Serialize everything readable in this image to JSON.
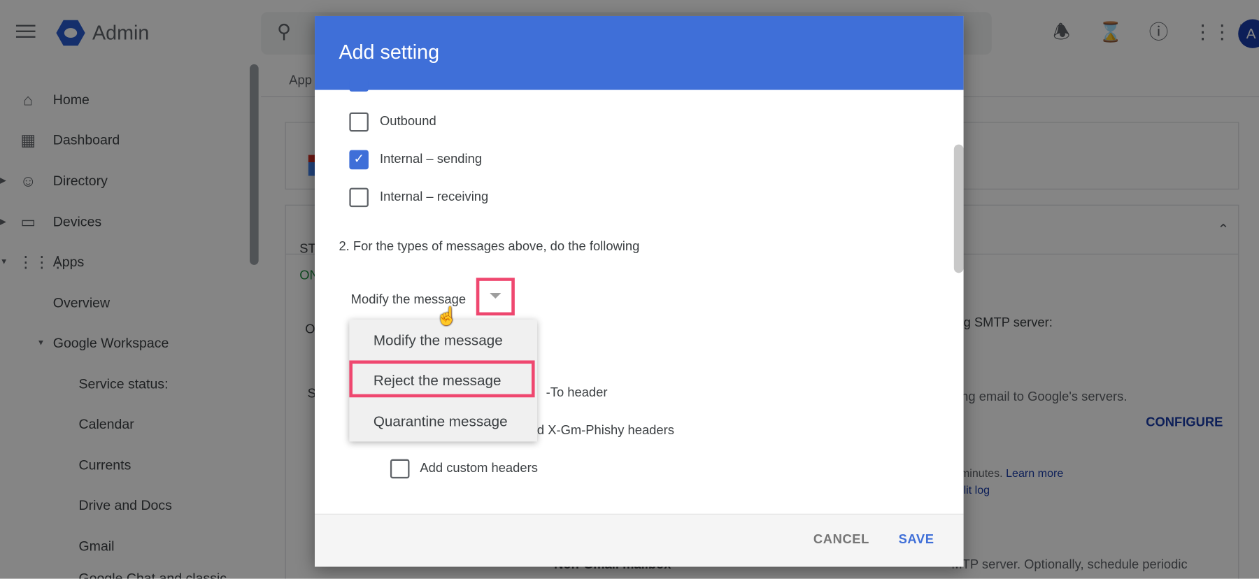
{
  "topbar": {
    "app_name": "Admin",
    "icons": [
      "menu-icon",
      "search-icon",
      "bell-icon",
      "hourglass-icon",
      "help-icon",
      "apps-grid-icon"
    ],
    "avatar_initial": "A"
  },
  "sidebar": {
    "items": [
      {
        "label": "Home",
        "icon": "home-icon"
      },
      {
        "label": "Dashboard",
        "icon": "dashboard-icon"
      },
      {
        "label": "Directory",
        "icon": "person-icon"
      },
      {
        "label": "Devices",
        "icon": "devices-icon"
      },
      {
        "label": "Apps",
        "icon": "apps-icon"
      },
      {
        "label": "Overview"
      },
      {
        "label": "Google Workspace"
      },
      {
        "label": "Service status:"
      },
      {
        "label": "Calendar"
      },
      {
        "label": "Currents"
      },
      {
        "label": "Drive and Docs"
      },
      {
        "label": "Gmail"
      },
      {
        "label": "Google Chat and classic"
      }
    ]
  },
  "background": {
    "breadcrumb": "App",
    "status_label": "ST",
    "status_value": "ON",
    "row_o": "O",
    "row_s": "S",
    "smtp_text": "g SMTP server:",
    "email_text": "ng email to Google's servers.",
    "configure": "CONFIGURE",
    "minutes_text": "v minutes.",
    "learn_more": "Learn more",
    "audit_log": "lit log",
    "non_gmail": "Non-Gmail mailbox",
    "smtp_text2": "MTP server. Optionally, schedule periodic",
    "status_color": "#1e8e3e"
  },
  "dialog": {
    "title": "Add setting",
    "checkboxes": [
      {
        "label": "Outbound",
        "checked": false
      },
      {
        "label": "Internal – sending",
        "checked": true
      },
      {
        "label": "Internal – receiving",
        "checked": false
      }
    ],
    "section_label": "2. For the types of messages above, do the following",
    "action_select": {
      "value": "Modify the message",
      "options": [
        "Modify the message",
        "Reject the message",
        "Quarantine message"
      ],
      "highlighted": "Reject the message"
    },
    "behind_text_1": "-To header",
    "behind_text_2": "nd X-Gm-Phishy headers",
    "custom_headers": {
      "label": "Add custom headers",
      "checked": false
    },
    "cancel": "CANCEL",
    "save": "SAVE",
    "accent": "#3f6fd8",
    "highlight_color": "#ef476f"
  }
}
